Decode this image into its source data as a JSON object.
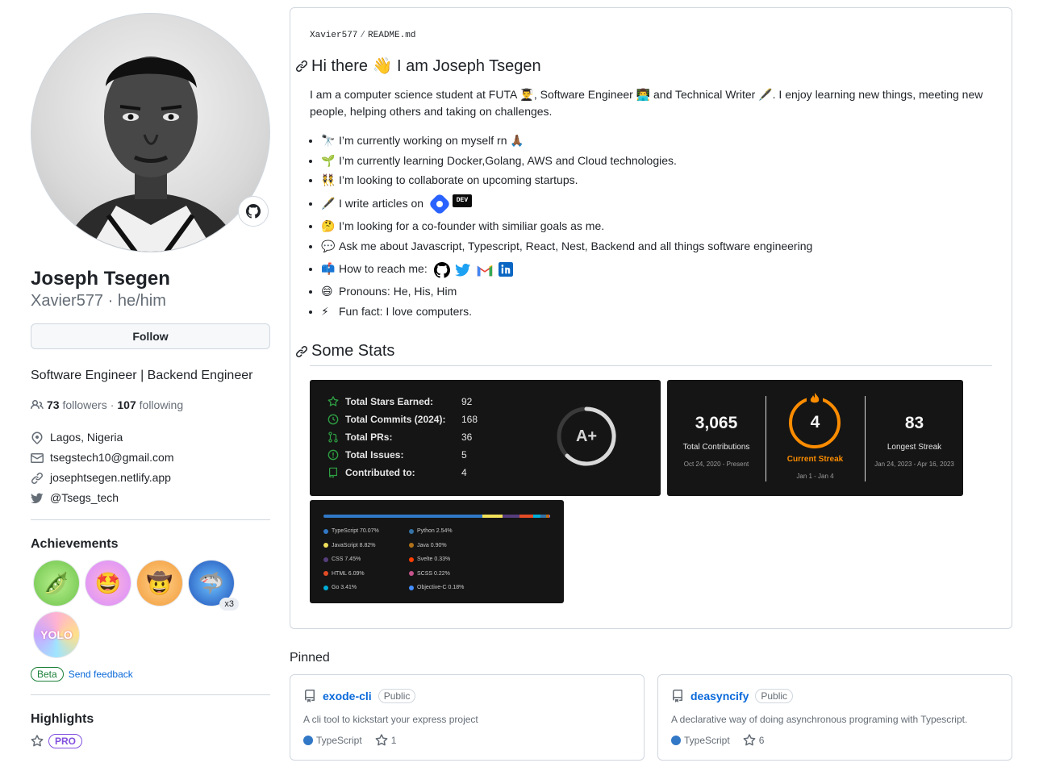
{
  "profile": {
    "fullname": "Joseph Tsegen",
    "login": "Xavier577",
    "pronouns": "he/him",
    "separator": "·",
    "follow_label": "Follow",
    "bio": "Software Engineer | Backend Engineer",
    "followers_count": "73",
    "followers_label": "followers",
    "following_count": "107",
    "following_label": "following",
    "dot": "·",
    "location": "Lagos, Nigeria",
    "email": "tsegstech10@gmail.com",
    "website": "josephtsegen.netlify.app",
    "twitter": "@Tsegs_tech"
  },
  "achievements": {
    "title": "Achievements",
    "badges": [
      {
        "name": "pair-extraordinaire",
        "emoji": "🫛",
        "count": ""
      },
      {
        "name": "starstruck",
        "emoji": "🤩",
        "count": ""
      },
      {
        "name": "quickdraw",
        "emoji": "🤠",
        "count": ""
      },
      {
        "name": "pull-shark",
        "emoji": "🦈",
        "count": "x3"
      },
      {
        "name": "yolo",
        "emoji": "YOLO",
        "count": ""
      }
    ],
    "beta_label": "Beta",
    "feedback_label": "Send feedback"
  },
  "highlights": {
    "title": "Highlights",
    "pro_label": "PRO"
  },
  "readme": {
    "owner": "Xavier577",
    "path_sep": "/",
    "file": "README.md",
    "heading": "Hi there 👋  I am Joseph Tsegen",
    "intro": "I am a computer science student at FUTA 👨‍🎓, Software Engineer 👨‍💻 and Technical Writer 🖋️. I enjoy learning new things, meeting new people, helping others and taking on challenges.",
    "items": [
      {
        "emoji": "🔭",
        "text": "I’m currently working on myself rn 🙏🏾"
      },
      {
        "emoji": "🌱",
        "text": "I’m currently learning Docker,Golang, AWS and Cloud technologies."
      },
      {
        "emoji": "👯",
        "text": "I’m looking to collaborate on upcoming startups."
      },
      {
        "emoji": "🖋️",
        "text": "I write articles on"
      },
      {
        "emoji": "🤔",
        "text": "I’m looking for a co-founder with similiar goals as me."
      },
      {
        "emoji": "💬",
        "text": "Ask me about Javascript, Typescript, React, Nest, Backend and all things software engineering"
      },
      {
        "emoji": "📫",
        "text": "How to reach me:"
      },
      {
        "emoji": "😄",
        "text": "Pronouns: He, His, Him"
      },
      {
        "emoji": "⚡",
        "text": "Fun fact: I love computers."
      }
    ],
    "dev_badge": "DEV",
    "stats_heading": "Some Stats"
  },
  "stats_card": {
    "rows": [
      {
        "icon": "star-icon",
        "label": "Total Stars Earned:",
        "value": "92"
      },
      {
        "icon": "history-icon",
        "label": "Total Commits (2024):",
        "value": "168"
      },
      {
        "icon": "pr-icon",
        "label": "Total PRs:",
        "value": "36"
      },
      {
        "icon": "issue-icon",
        "label": "Total Issues:",
        "value": "5"
      },
      {
        "icon": "repo-icon",
        "label": "Contributed to:",
        "value": "4"
      }
    ],
    "grade": "A+",
    "accent": "#2ea043"
  },
  "streak_card": {
    "total_value": "3,065",
    "total_label": "Total Contributions",
    "total_range": "Oct 24, 2020 - Present",
    "current_value": "4",
    "current_label": "Current Streak",
    "current_range": "Jan 1 - Jan 4",
    "longest_value": "83",
    "longest_label": "Longest Streak",
    "longest_range": "Jan 24, 2023 - Apr 16, 2023",
    "accent": "#fb8c00"
  },
  "langs_card": {
    "languages": [
      {
        "name": "TypeScript",
        "percent": "70.07%",
        "value": 70.07,
        "color": "#3178c6"
      },
      {
        "name": "JavaScript",
        "percent": "8.82%",
        "value": 8.82,
        "color": "#f1e05a"
      },
      {
        "name": "CSS",
        "percent": "7.45%",
        "value": 7.45,
        "color": "#563d7c"
      },
      {
        "name": "HTML",
        "percent": "6.09%",
        "value": 6.09,
        "color": "#e34c26"
      },
      {
        "name": "Go",
        "percent": "3.41%",
        "value": 3.41,
        "color": "#00add8"
      },
      {
        "name": "Python",
        "percent": "2.54%",
        "value": 2.54,
        "color": "#3572a5"
      },
      {
        "name": "Java",
        "percent": "0.90%",
        "value": 0.9,
        "color": "#b07219"
      },
      {
        "name": "Svelte",
        "percent": "0.33%",
        "value": 0.33,
        "color": "#ff3e00"
      },
      {
        "name": "SCSS",
        "percent": "0.22%",
        "value": 0.22,
        "color": "#c6538c"
      },
      {
        "name": "Objective-C",
        "percent": "0.18%",
        "value": 0.18,
        "color": "#438eff"
      }
    ]
  },
  "pinned": {
    "title": "Pinned",
    "repos": [
      {
        "name": "exode-cli",
        "visibility": "Public",
        "description": "A cli tool to kickstart your express project",
        "language": "TypeScript",
        "stars": "1"
      },
      {
        "name": "deasyncify",
        "visibility": "Public",
        "description": "A declarative way of doing asynchronous programing with Typescript.",
        "language": "TypeScript",
        "stars": "6"
      }
    ]
  }
}
